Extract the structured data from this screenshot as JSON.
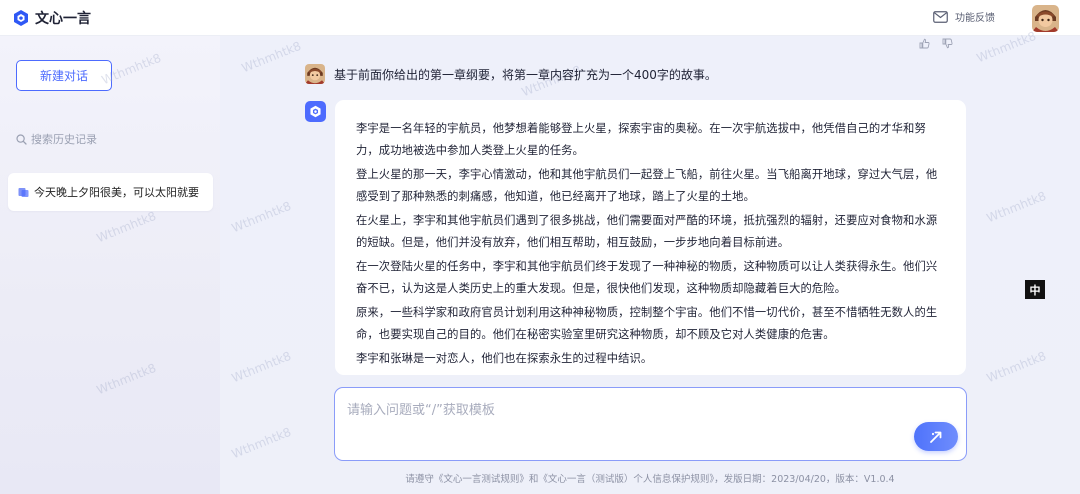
{
  "app": {
    "name": "文心一言",
    "feedback_label": "功能反馈"
  },
  "sidebar": {
    "new_chat_label": "新建对话",
    "search_placeholder": "搜索历史记录",
    "history": [
      {
        "label": "今天晚上夕阳很美，可以太阳就要"
      }
    ]
  },
  "conversation": {
    "user_message": "基于前面你给出的第一章纲要，将第一章内容扩充为一个400字的故事。",
    "answer_paragraphs": [
      "李宇是一名年轻的宇航员，他梦想着能够登上火星，探索宇宙的奥秘。在一次宇航选拔中，他凭借自己的才华和努力，成功地被选中参加人类登上火星的任务。",
      "登上火星的那一天，李宇心情激动，他和其他宇航员们一起登上飞船，前往火星。当飞船离开地球，穿过大气层，他感受到了那种熟悉的刺痛感，他知道，他已经离开了地球，踏上了火星的土地。",
      "在火星上，李宇和其他宇航员们遇到了很多挑战，他们需要面对严酷的环境，抵抗强烈的辐射，还要应对食物和水源的短缺。但是，他们并没有放弃，他们相互帮助，相互鼓励，一步步地向着目标前进。",
      "在一次登陆火星的任务中，李宇和其他宇航员们终于发现了一种神秘的物质，这种物质可以让人类获得永生。他们兴奋不已，认为这是人类历史上的重大发现。但是，很快他们发现，这种物质却隐藏着巨大的危险。",
      "原来，一些科学家和政府官员计划利用这种神秘物质，控制整个宇宙。他们不惜一切代价，甚至不惜牺牲无数人的生命，也要实现自己的目的。他们在秘密实验室里研究这种物质，却不顾及它对人类健康的危害。",
      "李宇和张琳是一对恋人，他们也在探索永生的过程中结识。"
    ]
  },
  "input": {
    "placeholder": "请输入问题或“/”获取模板"
  },
  "lang_badge": "中",
  "footer": "请遵守《文心一言测试规则》和《文心一言（测试版）个人信息保护规则》，发版日期：2023/04/20，版本：V1.0.4",
  "watermark_text": "Wthmhtk8",
  "colors": {
    "accent": "#4d6bfe",
    "background": "#eef0f9"
  },
  "icons": {
    "logo": "wenxin-logo-icon",
    "feedback": "mail-icon",
    "search": "search-icon",
    "history_item": "chat-icon",
    "thumbs_up": "thumbs-up-icon",
    "thumbs_down": "thumbs-down-icon",
    "send": "send-icon"
  }
}
